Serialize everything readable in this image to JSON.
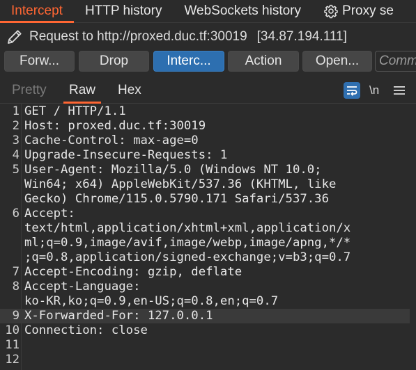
{
  "tabs": [
    {
      "label": "Intercept",
      "active": true
    },
    {
      "label": "HTTP history",
      "active": false
    },
    {
      "label": "WebSockets history",
      "active": false
    },
    {
      "label": "Proxy se",
      "icon": "gear-icon",
      "active": false
    }
  ],
  "request_info": {
    "icon": "pencil-icon",
    "label": "Request to http://proxed.duc.tf:30019",
    "ip": "[34.87.194.111]"
  },
  "buttons": {
    "forward": "Forw...",
    "drop": "Drop",
    "intercept": "Interc...",
    "action": "Action",
    "open": "Open...",
    "comment_placeholder": "Comm"
  },
  "view_tabs": {
    "pretty": "Pretty",
    "raw": "Raw",
    "hex": "Hex",
    "active": "Raw"
  },
  "editor_tools": {
    "wrap_icon": "wrap-lines-icon",
    "newline_label": "\\n",
    "menu_icon": "hamburger-menu-icon"
  },
  "colors": {
    "accent": "#ff6633",
    "primary_button": "#2d6fb0",
    "background": "#2b2b2b"
  },
  "request_lines": [
    {
      "num": "1",
      "segments": [
        "GET / HTTP/1.1"
      ]
    },
    {
      "num": "2",
      "segments": [
        "Host: proxed.duc.tf:30019"
      ]
    },
    {
      "num": "3",
      "segments": [
        "Cache-Control: max-age=0"
      ]
    },
    {
      "num": "4",
      "segments": [
        "Upgrade-Insecure-Requests: 1"
      ]
    },
    {
      "num": "5",
      "segments": [
        "User-Agent: Mozilla/5.0 (Windows NT 10.0;",
        "Win64; x64) AppleWebKit/537.36 (KHTML, like",
        "Gecko) Chrome/115.0.5790.171 Safari/537.36"
      ]
    },
    {
      "num": "6",
      "segments": [
        "Accept:",
        "text/html,application/xhtml+xml,application/x",
        "ml;q=0.9,image/avif,image/webp,image/apng,*/*",
        ";q=0.8,application/signed-exchange;v=b3;q=0.7"
      ]
    },
    {
      "num": "7",
      "segments": [
        "Accept-Encoding: gzip, deflate"
      ]
    },
    {
      "num": "8",
      "segments": [
        "Accept-Language:",
        "ko-KR,ko;q=0.9,en-US;q=0.8,en;q=0.7"
      ]
    },
    {
      "num": "9",
      "segments": [
        "X-Forwarded-For: 127.0.0.1"
      ],
      "highlighted": true
    },
    {
      "num": "10",
      "segments": [
        "Connection: close"
      ]
    },
    {
      "num": "11",
      "segments": [
        ""
      ]
    },
    {
      "num": "12",
      "segments": [
        ""
      ]
    }
  ]
}
